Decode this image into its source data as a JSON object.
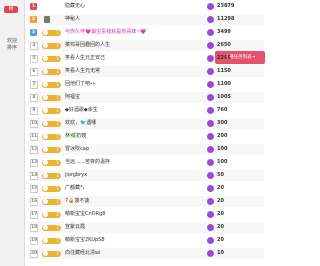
{
  "sidebar": {
    "badge": "榜",
    "title_line1": "欢迎",
    "title_line2": "排序"
  },
  "action_button": "主播任务列表→",
  "rows": [
    {
      "rank": "1",
      "rank_style": "r1",
      "lvl": "",
      "lvl_style": "",
      "name": "隐藏无心",
      "name_hl": false,
      "score": "23879"
    },
    {
      "rank": "2",
      "rank_style": "r2",
      "lvl": "",
      "lvl_style": "user",
      "name": "神秘人",
      "name_hl": false,
      "score": "11298"
    },
    {
      "rank": "3",
      "rank_style": "r3",
      "lvl": "1",
      "lvl_style": "",
      "name": "与你久伴💗最宝贵我就是你哥妹~💗",
      "name_hl": true,
      "score": "3499"
    },
    {
      "rank": "4",
      "rank_style": "rn",
      "lvl": "1",
      "lvl_style": "",
      "name": "菜鸡哥回趣回的人生",
      "name_hl": false,
      "score": "2650"
    },
    {
      "rank": "5",
      "rank_style": "rn",
      "lvl": "1",
      "lvl_style": "",
      "name": "笑看人生元正安己",
      "name_hl": false,
      "score": "2265"
    },
    {
      "rank": "6",
      "rank_style": "rn",
      "lvl": "1",
      "lvl_style": "",
      "name": "笑看人生元无常",
      "name_hl": false,
      "score": "1150"
    },
    {
      "rank": "7",
      "rank_style": "rn",
      "lvl": "1",
      "lvl_style": "",
      "name": "回他们了吧👀",
      "name_hl": false,
      "score": "1100"
    },
    {
      "rank": "8",
      "rank_style": "rn",
      "lvl": "1",
      "lvl_style": "",
      "name": "阿福宝",
      "name_hl": false,
      "score": "1005"
    },
    {
      "rank": "9",
      "rank_style": "rn",
      "lvl": "1",
      "lvl_style": "",
      "name": "◆好酒歌◆余生",
      "name_hl": false,
      "score": "760"
    },
    {
      "rank": "10",
      "rank_style": "rn",
      "lvl": "1",
      "lvl_style": "",
      "name": "欢欢，🐦遇哪",
      "name_hl": false,
      "score": "300"
    },
    {
      "rank": "11",
      "rank_style": "rn",
      "lvl": "1",
      "lvl_style": "",
      "name": "林🌿奶嫂",
      "name_hl": false,
      "score": "200"
    },
    {
      "rank": "12",
      "rank_style": "rn",
      "lvl": "1",
      "lvl_style": "",
      "name": "冒冰吹cap",
      "name_hl": false,
      "score": "100"
    },
    {
      "rank": "13",
      "rank_style": "rn",
      "lvl": "1",
      "lvl_style": "",
      "name": "当远……苦夜的温存",
      "name_hl": false,
      "score": "100"
    },
    {
      "rank": "14",
      "rank_style": "rn",
      "lvl": "1",
      "lvl_style": "",
      "name": "jiorgbryx",
      "name_hl": false,
      "score": "50"
    },
    {
      "rank": "15",
      "rank_style": "rn",
      "lvl": "1",
      "lvl_style": "",
      "name": "广都藏*₁",
      "name_hl": false,
      "score": "20"
    },
    {
      "rank": "16",
      "rank_style": "rn",
      "lvl": "1",
      "lvl_style": "",
      "name": "7🔒菠不菠",
      "name_hl": false,
      "score": "20"
    },
    {
      "rank": "17",
      "rank_style": "rn",
      "lvl": "1",
      "lvl_style": "",
      "name": "萌新宝宝CnORg8",
      "name_hl": false,
      "score": "20"
    },
    {
      "rank": "18",
      "rank_style": "rn",
      "lvl": "1",
      "lvl_style": "",
      "name": "宣紫云霞",
      "name_hl": false,
      "score": "20"
    },
    {
      "rank": "19",
      "rank_style": "rn",
      "lvl": "1",
      "lvl_style": "",
      "name": "萌新宝宝2KUpS8",
      "name_hl": false,
      "score": "20"
    },
    {
      "rank": "20",
      "rank_style": "rn",
      "lvl": "1",
      "lvl_style": "",
      "name": "向往藏经北漂wi",
      "name_hl": false,
      "score": "10"
    }
  ],
  "colors": {
    "accent": "#e8516e",
    "score_icon": "#9b4bd1",
    "level_badge": "#e9b23b"
  },
  "icons": {
    "score": "coin-icon",
    "user": "user-icon"
  }
}
